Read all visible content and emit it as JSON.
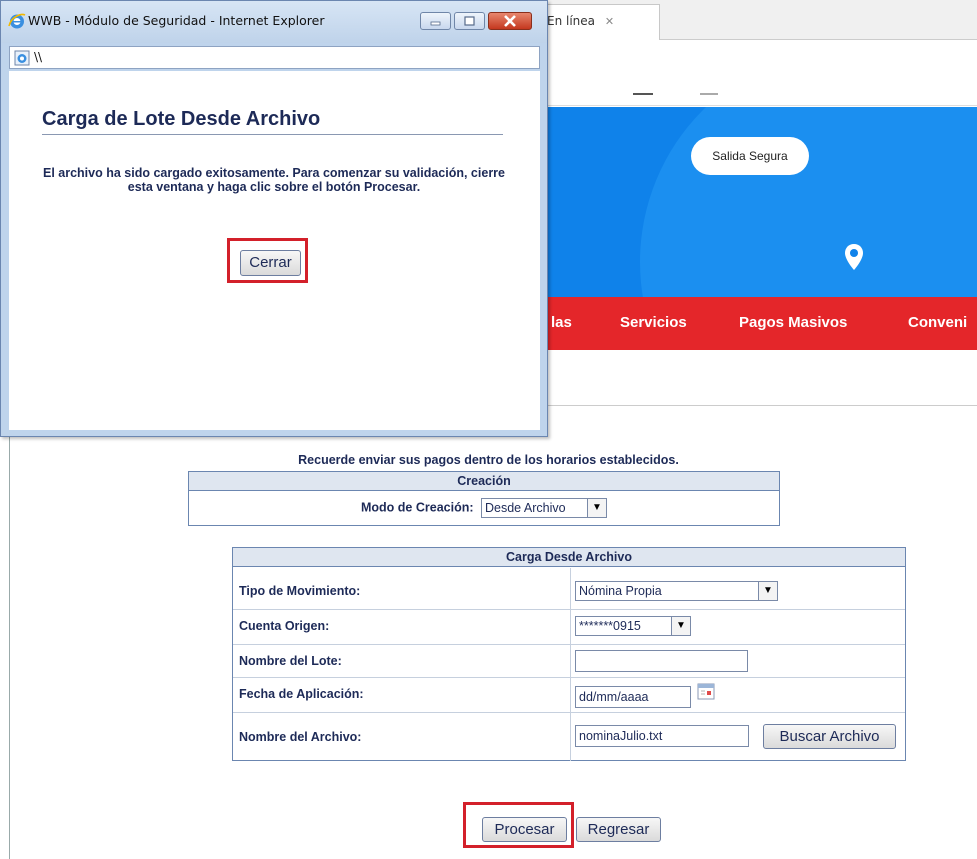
{
  "background": {
    "tab_title": "En línea",
    "tab_close": "✕",
    "salida_segura": "Salida Segura",
    "nav": [
      "las",
      "Servicios",
      "Pagos Masivos",
      "Conveni"
    ]
  },
  "popup": {
    "window_title": "WWB - Módulo de Seguridad - Internet Explorer",
    "address": "\\\\",
    "heading": "Carga de Lote Desde Archivo",
    "message": "El archivo ha sido cargado exitosamente. Para comenzar su validación, cierre esta ventana y haga clic sobre el botón Procesar.",
    "close_button": "Cerrar"
  },
  "form": {
    "reminder": "Recuerde enviar sus pagos dentro de los horarios establecidos.",
    "creacion": {
      "header": "Creación",
      "modo_label": "Modo de Creación:",
      "modo_value": "Desde Archivo"
    },
    "carga": {
      "header": "Carga Desde Archivo",
      "tipo_label": "Tipo de Movimiento:",
      "tipo_value": "Nómina Propia",
      "cuenta_label": "Cuenta Origen:",
      "cuenta_value": "*******0915",
      "nombre_lote_label": "Nombre del Lote:",
      "nombre_lote_value": "",
      "fecha_label": "Fecha de Aplicación:",
      "fecha_value": "dd/mm/aaaa",
      "archivo_label": "Nombre del Archivo:",
      "archivo_value": "nominaJulio.txt",
      "buscar_button": "Buscar Archivo"
    },
    "procesar_button": "Procesar",
    "regresar_button": "Regresar"
  },
  "colors": {
    "hero_blue": "#0f82ea",
    "nav_red": "#e4262a",
    "text_navy": "#1d2a57",
    "highlight_red": "#d3202a"
  }
}
